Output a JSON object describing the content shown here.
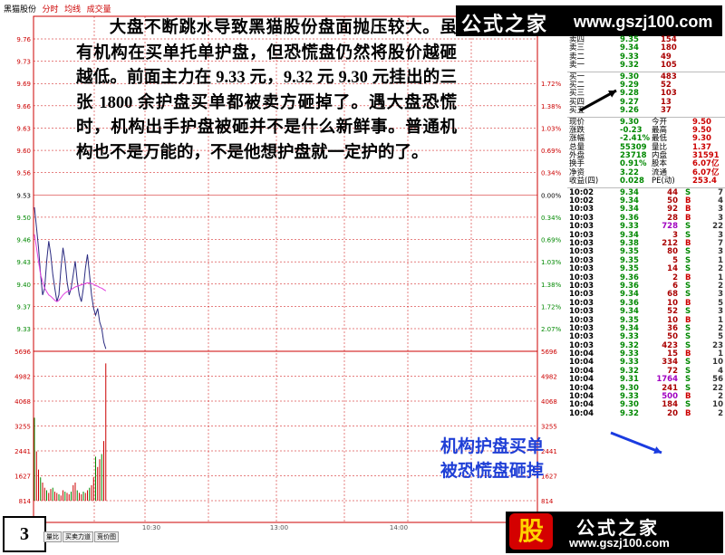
{
  "topbar": {
    "stock": "黑猫股份",
    "tab1": "分时",
    "tab2": "均线",
    "tab3": "成交量"
  },
  "article": {
    "paragraph": "大盘不断跳水导致黑猫股份盘面抛压较大。虽有机构在买单托单护盘，但恐慌盘仍然将股价越砸越低。前面主力在 9.33 元，9.32 元 9.30 元挂出的三张 1800 余护盘买单都被卖方砸掉了。遇大盘恐慌时，机构出手护盘被砸并不是什么新鲜事。普通机构也不是万能的，不是他想护盘就一定护的了。"
  },
  "watermark": {
    "logo": "公式之家",
    "url": "www.gszj100.com"
  },
  "note": {
    "line1": "机构护盘买单",
    "line2": "被恐慌盘砸掉"
  },
  "page_number": "3",
  "bottom_tabs": [
    "量比",
    "买卖力道",
    "竞价图"
  ],
  "footer": {
    "badge": "股",
    "name": "公式之家",
    "url": "www.gszj100.com"
  },
  "chart_data": {
    "type": "line",
    "y_price_ticks": [
      "9.76",
      "9.73",
      "9.69",
      "9.66",
      "9.63",
      "9.60",
      "9.56",
      "9.53",
      "9.50",
      "9.46",
      "9.43",
      "9.40",
      "9.37",
      "9.33"
    ],
    "y_pct_ticks": [
      "",
      "",
      "1.72%",
      "1.38%",
      "1.03%",
      "0.69%",
      "0.34%",
      "0.00%",
      "0.34%",
      "0.69%",
      "1.03%",
      "1.38%",
      "1.72%",
      "2.07%"
    ],
    "vol_left_ticks": [
      "5696",
      "4982",
      "4068",
      "3255",
      "2441",
      "1627",
      "814"
    ],
    "vol_right_ticks": [
      "5696",
      "4982",
      "4068",
      "3255",
      "2441",
      "1627",
      "814"
    ],
    "x_ticks": [
      "10:30",
      "13:00",
      "14:00"
    ],
    "price_series": [
      9.51,
      9.48,
      9.45,
      9.41,
      9.38,
      9.39,
      9.43,
      9.46,
      9.44,
      9.41,
      9.39,
      9.37,
      9.38,
      9.42,
      9.45,
      9.43,
      9.4,
      9.38,
      9.39,
      9.41,
      9.43,
      9.4,
      9.38,
      9.37,
      9.39,
      9.42,
      9.44,
      9.41,
      9.38,
      9.36,
      9.35,
      9.36,
      9.34,
      9.33,
      9.31,
      9.3
    ],
    "avg_series": [
      9.47,
      9.45,
      9.43,
      9.41,
      9.4,
      9.39,
      9.385,
      9.38,
      9.378,
      9.375,
      9.372,
      9.37,
      9.372,
      9.376,
      9.38,
      9.383,
      9.385,
      9.386,
      9.388,
      9.39,
      9.392,
      9.393,
      9.394,
      9.395,
      9.396,
      9.397,
      9.398,
      9.398,
      9.397,
      9.396,
      9.394,
      9.393,
      9.391,
      9.39,
      9.388,
      9.386
    ],
    "volume_series": [
      3200,
      1900,
      1200,
      900,
      700,
      500,
      400,
      300,
      450,
      500,
      350,
      300,
      250,
      200,
      400,
      350,
      300,
      250,
      350,
      600,
      700,
      400,
      300,
      250,
      350,
      300,
      400,
      500,
      600,
      900,
      1700,
      1300,
      1600,
      1800,
      2300,
      5300
    ]
  },
  "quote_panel": {
    "asks": [
      {
        "label": "卖四",
        "price": "9.35",
        "vol": "154"
      },
      {
        "label": "卖三",
        "price": "9.34",
        "vol": "180"
      },
      {
        "label": "卖二",
        "price": "9.33",
        "vol": "49"
      },
      {
        "label": "卖一",
        "price": "9.32",
        "vol": "105"
      }
    ],
    "bids": [
      {
        "label": "买一",
        "price": "9.30",
        "vol": "483"
      },
      {
        "label": "买二",
        "price": "9.29",
        "vol": "52"
      },
      {
        "label": "买三",
        "price": "9.28",
        "vol": "103"
      },
      {
        "label": "买四",
        "price": "9.27",
        "vol": "13"
      },
      {
        "label": "买五",
        "price": "9.26",
        "vol": "37"
      }
    ],
    "stats": [
      {
        "l1": "现价",
        "v1": "9.30",
        "l2": "今开",
        "v2": "9.50"
      },
      {
        "l1": "涨跌",
        "v1": "-0.23",
        "l2": "最高",
        "v2": "9.50"
      },
      {
        "l1": "涨幅",
        "v1": "-2.41%",
        "l2": "最低",
        "v2": "9.30"
      },
      {
        "l1": "总量",
        "v1": "55309",
        "l2": "量比",
        "v2": "1.37"
      },
      {
        "l1": "外盘",
        "v1": "23718",
        "l2": "内盘",
        "v2": "31591"
      },
      {
        "l1": "换手",
        "v1": "0.91%",
        "l2": "股本",
        "v2": "6.07亿"
      },
      {
        "l1": "净资",
        "v1": "3.22",
        "l2": "流通",
        "v2": "6.07亿"
      },
      {
        "l1": "收益(四)",
        "v1": "0.028",
        "l2": "PE(动)",
        "v2": "253.4"
      }
    ],
    "ticks": [
      {
        "t": "10:02",
        "p": "9.34",
        "v": "44",
        "bs": "S",
        "n": "7"
      },
      {
        "t": "10:02",
        "p": "9.34",
        "v": "50",
        "bs": "B",
        "n": "4"
      },
      {
        "t": "10:03",
        "p": "9.34",
        "v": "92",
        "bs": "B",
        "n": "3"
      },
      {
        "t": "10:03",
        "p": "9.36",
        "v": "28",
        "bs": "B",
        "n": "3"
      },
      {
        "t": "10:03",
        "p": "9.33",
        "v": "728",
        "bs": "S",
        "n": "22",
        "purple": true
      },
      {
        "t": "10:03",
        "p": "9.34",
        "v": "3",
        "bs": "S",
        "n": "3"
      },
      {
        "t": "10:03",
        "p": "9.38",
        "v": "212",
        "bs": "B",
        "n": "7"
      },
      {
        "t": "10:03",
        "p": "9.35",
        "v": "80",
        "bs": "S",
        "n": "3"
      },
      {
        "t": "10:03",
        "p": "9.35",
        "v": "5",
        "bs": "S",
        "n": "1"
      },
      {
        "t": "10:03",
        "p": "9.35",
        "v": "14",
        "bs": "S",
        "n": "2"
      },
      {
        "t": "10:03",
        "p": "9.36",
        "v": "2",
        "bs": "B",
        "n": "1"
      },
      {
        "t": "10:03",
        "p": "9.36",
        "v": "6",
        "bs": "S",
        "n": "2"
      },
      {
        "t": "10:03",
        "p": "9.34",
        "v": "68",
        "bs": "S",
        "n": "3"
      },
      {
        "t": "10:03",
        "p": "9.36",
        "v": "10",
        "bs": "B",
        "n": "5"
      },
      {
        "t": "10:03",
        "p": "9.34",
        "v": "52",
        "bs": "S",
        "n": "3"
      },
      {
        "t": "10:03",
        "p": "9.35",
        "v": "10",
        "bs": "B",
        "n": "1"
      },
      {
        "t": "10:03",
        "p": "9.34",
        "v": "36",
        "bs": "S",
        "n": "2"
      },
      {
        "t": "10:03",
        "p": "9.33",
        "v": "50",
        "bs": "S",
        "n": "5"
      },
      {
        "t": "10:03",
        "p": "9.32",
        "v": "423",
        "bs": "S",
        "n": "23"
      },
      {
        "t": "10:04",
        "p": "9.33",
        "v": "15",
        "bs": "B",
        "n": "1"
      },
      {
        "t": "10:04",
        "p": "9.33",
        "v": "334",
        "bs": "S",
        "n": "10"
      },
      {
        "t": "10:04",
        "p": "9.32",
        "v": "72",
        "bs": "S",
        "n": "4"
      },
      {
        "t": "10:04",
        "p": "9.31",
        "v": "1764",
        "bs": "S",
        "n": "56",
        "purple": true
      },
      {
        "t": "10:04",
        "p": "9.30",
        "v": "241",
        "bs": "S",
        "n": "22"
      },
      {
        "t": "10:04",
        "p": "9.33",
        "v": "500",
        "bs": "B",
        "n": "2",
        "purple": true
      },
      {
        "t": "10:04",
        "p": "9.30",
        "v": "184",
        "bs": "S",
        "n": "10"
      },
      {
        "t": "10:04",
        "p": "9.32",
        "v": "20",
        "bs": "B",
        "n": "2"
      }
    ]
  },
  "colors": {
    "up": "#c00000",
    "down": "#008800",
    "line": "#2a2a80",
    "avg": "#e040e0",
    "accent_note": "#1f3fd6",
    "arrow_blue": "#1a3be0"
  }
}
